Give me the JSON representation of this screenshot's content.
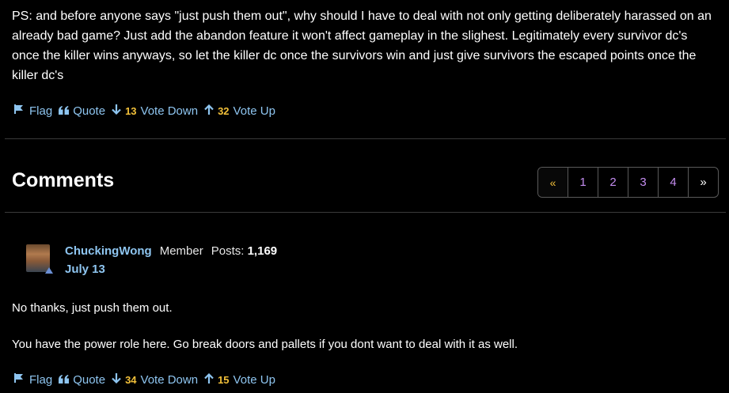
{
  "post": {
    "text": "PS: and before anyone says \"just push them out\", why should I have to deal with not only getting deliberately harassed on an already bad game? Just add the abandon feature it won't affect gameplay in the slighest. Legitimately every survivor dc's once the killer wins anyways, so let the killer dc once the survivors win and just give survivors the escaped points once the killer dc's",
    "actions": {
      "flag": "Flag",
      "quote": "Quote",
      "vote_down_count": "13",
      "vote_down": "Vote Down",
      "vote_up_count": "32",
      "vote_up": "Vote Up"
    }
  },
  "comments": {
    "title": "Comments",
    "pagination": {
      "prev": "«",
      "pages": [
        "1",
        "2",
        "3",
        "4"
      ],
      "next": "»"
    },
    "items": [
      {
        "username": "ChuckingWong",
        "role": "Member",
        "posts_label": "Posts:",
        "posts_count": "1,169",
        "date": "July 13",
        "body": [
          "No thanks, just push them out.",
          "You have the power role here. Go break doors and pallets if you dont want to deal with it as well."
        ],
        "actions": {
          "flag": "Flag",
          "quote": "Quote",
          "vote_down_count": "34",
          "vote_down": "Vote Down",
          "vote_up_count": "15",
          "vote_up": "Vote Up"
        }
      }
    ]
  },
  "colors": {
    "background": "#000000",
    "link": "#8ec5f0",
    "count": "#f3c13a",
    "page_number": "#c48df0",
    "divider": "#3a3a3a"
  }
}
